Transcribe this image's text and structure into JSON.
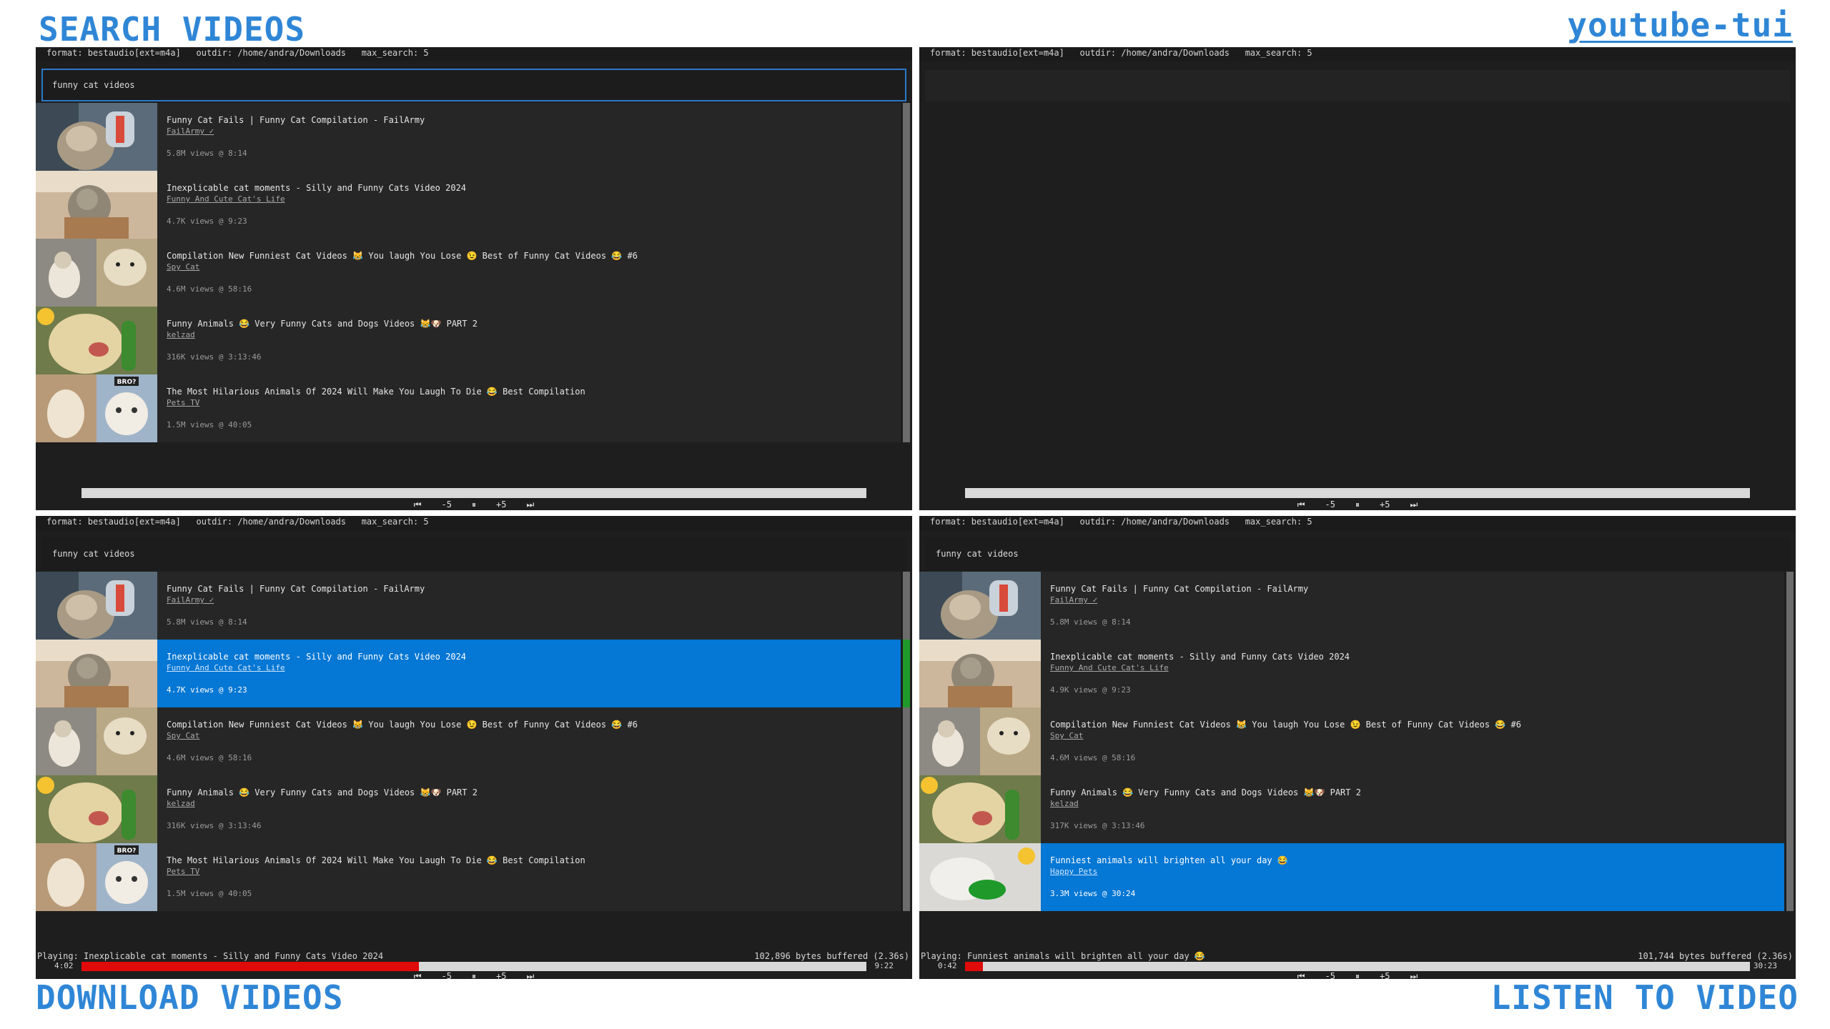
{
  "captions": {
    "search": "SEARCH VIDEOS",
    "app": "youtube-tui",
    "download": "DOWNLOAD VIDEOS",
    "listen": "LISTEN TO VIDEO"
  },
  "status_bar": "format: bestaudio[ext=m4a]   outdir: /home/andra/Downloads   max_search: 5",
  "search_query": "funny cat videos",
  "controls": {
    "prev": "⏮",
    "back5": "-5",
    "pause": "⏸",
    "fwd5": "+5",
    "next": "⏭"
  },
  "results_a": [
    {
      "title": "Funny Cat Fails | Funny Cat Compilation - FailArmy",
      "channel": "FailArmy ✓",
      "meta": "5.8M views @ 8:14"
    },
    {
      "title": "Inexplicable cat moments - Silly and Funny Cats Video 2024",
      "channel": "Funny And Cute Cat's Life",
      "meta": "4.7K views @ 9:23"
    },
    {
      "title": "Compilation New Funniest Cat Videos 😹 You laugh You Lose 😉 Best of Funny Cat Videos 😂 #6",
      "channel": "Spy Cat",
      "meta": "4.6M views @ 58:16"
    },
    {
      "title": "Funny Animals 😂 Very Funny Cats and Dogs Videos 😹🐶 PART 2",
      "channel": "kelzad",
      "meta": "316K views @ 3:13:46"
    },
    {
      "title": "The Most Hilarious Animals Of 2024 Will Make You Laugh To Die 😂  Best Compilation",
      "channel": "Pets TV",
      "meta": "1.5M views @ 40:05"
    }
  ],
  "results_b": [
    {
      "title": "Funny Cat Fails | Funny Cat Compilation - FailArmy",
      "channel": "FailArmy ✓",
      "meta": "5.8M views @ 8:14"
    },
    {
      "title": "Inexplicable cat moments - Silly and Funny Cats Video 2024",
      "channel": "Funny And Cute Cat's Life",
      "meta": "4.9K views @ 9:23"
    },
    {
      "title": "Compilation New Funniest Cat Videos 😹 You laugh You Lose 😉 Best of Funny Cat Videos 😂 #6",
      "channel": "Spy Cat",
      "meta": "4.6M views @ 58:16"
    },
    {
      "title": "Funny Animals 😂 Very Funny Cats and Dogs Videos 😹🐶 PART 2",
      "channel": "kelzad",
      "meta": "317K views @ 3:13:46"
    },
    {
      "title": "Funniest animals will brighten all your day 😂",
      "channel": "Happy Pets",
      "meta": "3.3M views @ 30:24"
    }
  ],
  "download_panel": {
    "playing_prefix": "Playing: ",
    "playing_title": "Inexplicable cat moments - Silly and Funny Cats Video 2024",
    "buffer": "102,896 bytes buffered (2.36s)",
    "time_elapsed": "4:02",
    "time_total": "9:22",
    "progress": 0.43
  },
  "listen_panel": {
    "playing_prefix": "Playing: ",
    "playing_title": "Funniest animals will brighten all your day 😂",
    "buffer": "101,744 bytes buffered (2.36s)",
    "time_elapsed": "0:42",
    "time_total": "30:23",
    "progress": 0.023
  },
  "thumb_badge": "BRO?",
  "colors": {
    "accent": "#2f86d6",
    "selection": "#0577d4",
    "progress_fill": "#e10a0a",
    "scroll_active": "#1f9a2a",
    "terminal_bg": "#1e1e1e"
  }
}
